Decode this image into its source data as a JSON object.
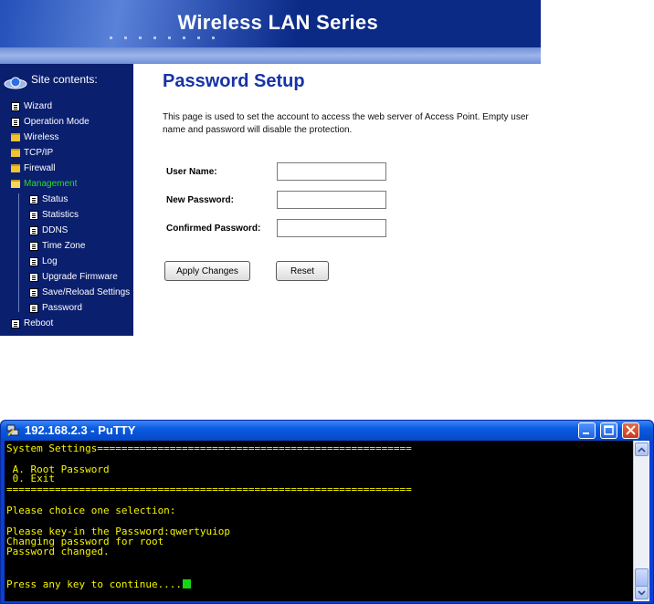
{
  "router": {
    "banner_title": "Wireless LAN Series",
    "sidebar": {
      "header": "Site contents:",
      "items": [
        {
          "label": "Wizard",
          "icon": "page-icon"
        },
        {
          "label": "Operation Mode",
          "icon": "page-icon"
        },
        {
          "label": "Wireless",
          "icon": "folder-icon"
        },
        {
          "label": "TCP/IP",
          "icon": "folder-icon"
        },
        {
          "label": "Firewall",
          "icon": "folder-icon"
        },
        {
          "label": "Management",
          "icon": "folder-open-icon",
          "active": true
        },
        {
          "label": "Status",
          "icon": "page-icon"
        },
        {
          "label": "Statistics",
          "icon": "page-icon"
        },
        {
          "label": "DDNS",
          "icon": "page-icon"
        },
        {
          "label": "Time Zone",
          "icon": "page-icon"
        },
        {
          "label": "Log",
          "icon": "page-icon"
        },
        {
          "label": "Upgrade Firmware",
          "icon": "page-icon"
        },
        {
          "label": "Save/Reload Settings",
          "icon": "page-icon"
        },
        {
          "label": "Password",
          "icon": "page-icon"
        },
        {
          "label": "Reboot",
          "icon": "page-icon"
        }
      ]
    },
    "page_title": "Password Setup",
    "description": "This page is used to set the account to access the web server of Access Point. Empty user name and password will disable the protection.",
    "form": {
      "user_name_label": "User Name:",
      "new_password_label": "New Password:",
      "confirmed_password_label": "Confirmed Password:"
    },
    "buttons": {
      "apply": "Apply Changes",
      "reset": "Reset"
    },
    "colors": {
      "banner": "#0b2a86",
      "sidebar": "#0a1f6e",
      "title": "#1733a6",
      "active_item": "#2ed82e"
    }
  },
  "putty": {
    "window_title": "192.168.2.3 - PuTTY",
    "terminal_lines": [
      "System Settings====================================================",
      "",
      " A. Root Password",
      " 0. Exit",
      "===================================================================",
      "",
      "Please choice one selection:",
      "",
      "Please key-in the Password:qwertyuiop",
      "Changing password for root",
      "Password changed.",
      "",
      "",
      "Press any key to continue...."
    ],
    "colors": {
      "text": "#f5f500",
      "background": "#000000",
      "cursor": "#15d615"
    }
  }
}
